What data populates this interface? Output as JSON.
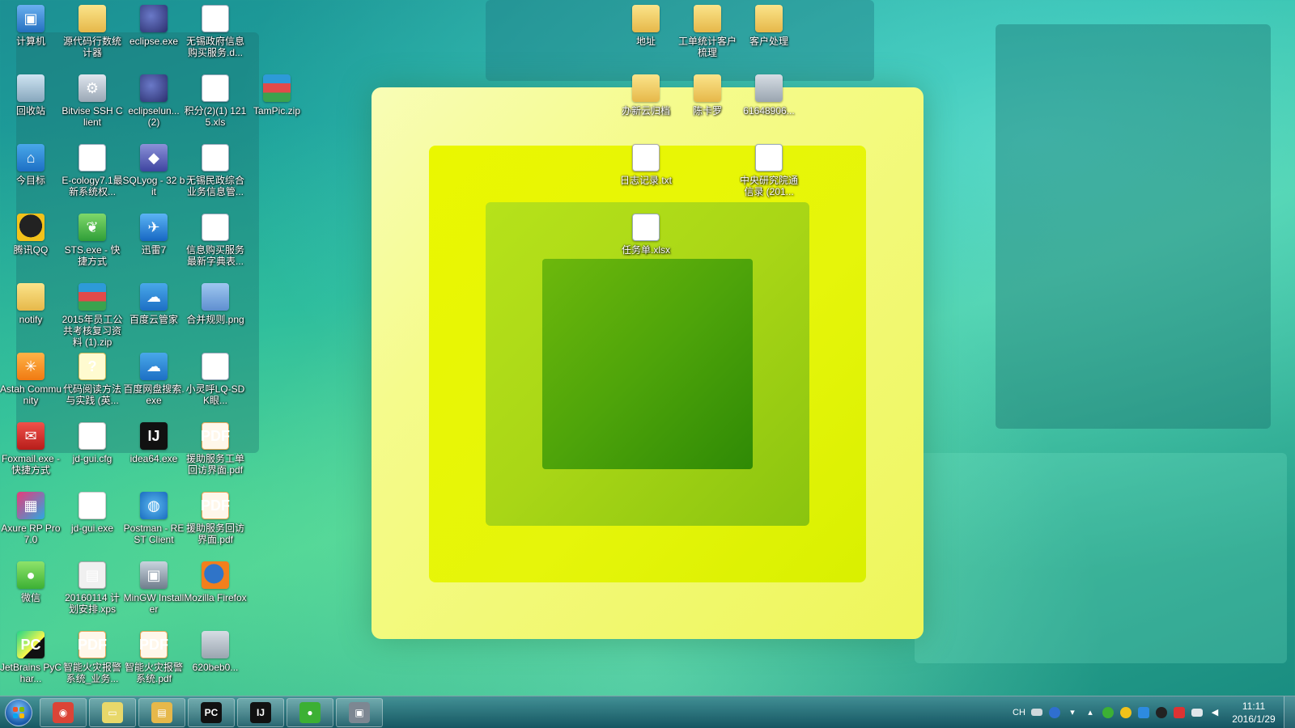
{
  "desktop_icons_left": [
    {
      "label": "计算机",
      "icon": "computer-icon",
      "style": "g-pc",
      "sym": "▣"
    },
    {
      "label": "源代码行数统计器",
      "icon": "folder-icon",
      "style": "g-folder",
      "sym": ""
    },
    {
      "label": "eclipse.exe",
      "icon": "eclipse-icon",
      "style": "g-eclipse",
      "sym": ""
    },
    {
      "label": "无锡政府信息购买服务.d...",
      "icon": "word-doc-icon",
      "style": "g-word",
      "sym": "W"
    },
    {
      "label": "回收站",
      "icon": "recycle-bin-icon",
      "style": "g-bin",
      "sym": ""
    },
    {
      "label": "Bitvise SSH Client",
      "icon": "bitvise-icon",
      "style": "g-ssh",
      "sym": "⚙"
    },
    {
      "label": "eclipselun... (2)",
      "icon": "eclipse-icon",
      "style": "g-eclipse",
      "sym": ""
    },
    {
      "label": "积分(2)(1) 1215.xls",
      "icon": "excel-icon",
      "style": "g-excel",
      "sym": "X"
    },
    {
      "label": "TamPic.zip",
      "icon": "zip-archive-icon",
      "style": "g-zip",
      "sym": ""
    },
    {
      "label": "今目标",
      "icon": "jinmubiao-icon",
      "style": "g-blue",
      "sym": "⌂"
    },
    {
      "label": "E-cology7.1最新系统权...",
      "icon": "word-doc-icon",
      "style": "g-word",
      "sym": "W"
    },
    {
      "label": "SQLyog - 32 bit",
      "icon": "sqlyog-icon",
      "style": "g-db",
      "sym": "◆"
    },
    {
      "label": "无锡民政综合业务信息管...",
      "icon": "excel-icon",
      "style": "g-excel",
      "sym": "X"
    },
    {
      "label": "腾讯QQ",
      "icon": "qq-penguin-icon",
      "style": "g-penguin",
      "sym": ""
    },
    {
      "label": "STS.exe - 快捷方式",
      "icon": "sts-leaf-icon",
      "style": "g-green",
      "sym": "❦"
    },
    {
      "label": "迅雷7",
      "icon": "xunlei-bird-icon",
      "style": "g-bird",
      "sym": "✈"
    },
    {
      "label": "信息购买服务最新字典表...",
      "icon": "excel-icon",
      "style": "g-excel",
      "sym": "X"
    },
    {
      "label": "notify",
      "icon": "folder-icon",
      "style": "g-folder",
      "sym": ""
    },
    {
      "label": "2015年员工公共考核复习资料 (1).zip",
      "icon": "zip-archive-icon",
      "style": "g-zip",
      "sym": ""
    },
    {
      "label": "百度云管家",
      "icon": "baidu-cloud-icon",
      "style": "g-blue",
      "sym": "☁"
    },
    {
      "label": "合并规则.png",
      "icon": "image-file-icon",
      "style": "g-png",
      "sym": ""
    },
    {
      "label": "Astah Community",
      "icon": "astah-icon",
      "style": "g-orange",
      "sym": "✳"
    },
    {
      "label": "代码阅读方法与实践 (英...",
      "icon": "help-file-icon",
      "style": "g-question",
      "sym": "?"
    },
    {
      "label": "百度网盘搜索.exe",
      "icon": "baidu-search-icon",
      "style": "g-blue",
      "sym": "☁"
    },
    {
      "label": "小灵呼LQ-SDK眼...",
      "icon": "word-doc-icon",
      "style": "g-word",
      "sym": "W"
    },
    {
      "label": "Foxmail.exe - 快捷方式",
      "icon": "foxmail-icon",
      "style": "g-red",
      "sym": "✉"
    },
    {
      "label": "jd-gui.cfg",
      "icon": "blank-file-icon",
      "style": "g-file",
      "sym": ""
    },
    {
      "label": "idea64.exe",
      "icon": "intellij-icon",
      "style": "g-idea",
      "sym": "IJ"
    },
    {
      "label": "援助服务工单回访界面.pdf",
      "icon": "pdf-icon",
      "style": "g-pdf",
      "sym": "PDF"
    },
    {
      "label": "Axure RP Pro 7.0",
      "icon": "axure-icon",
      "style": "g-axure",
      "sym": "▦"
    },
    {
      "label": "jd-gui.exe",
      "icon": "java-cup-icon",
      "style": "g-cup",
      "sym": "☕"
    },
    {
      "label": "Postman - REST Client",
      "icon": "postman-globe-icon",
      "style": "g-world",
      "sym": "◍"
    },
    {
      "label": "援助服务回访界面.pdf",
      "icon": "pdf-icon",
      "style": "g-pdf",
      "sym": "PDF"
    },
    {
      "label": "微信",
      "icon": "wechat-icon",
      "style": "g-wechat",
      "sym": "●"
    },
    {
      "label": "20160114 计划安排.xps",
      "icon": "xps-document-icon",
      "style": "g-xps",
      "sym": "▤"
    },
    {
      "label": "MinGW Installer",
      "icon": "mingw-installer-icon",
      "style": "g-mingw",
      "sym": "▣"
    },
    {
      "label": "Mozilla Firefox",
      "icon": "firefox-icon",
      "style": "g-firefox",
      "sym": ""
    },
    {
      "label": "JetBrains PyChar...",
      "icon": "pycharm-icon",
      "style": "g-pycharm",
      "sym": "PC"
    },
    {
      "label": "智能火灾报警系统_业务...",
      "icon": "pdf-icon",
      "style": "g-pdf",
      "sym": "PDF"
    },
    {
      "label": "智能火灾报警系统.pdf",
      "icon": "pdf-icon",
      "style": "g-pdf",
      "sym": "PDF"
    },
    {
      "label": "620beb0...",
      "icon": "photo-thumbnail-icon",
      "style": "g-photo",
      "sym": ""
    }
  ],
  "desktop_icons_right": [
    {
      "label": "地址",
      "icon": "folder-icon",
      "style": "g-folder",
      "sym": ""
    },
    {
      "label": "工单统计客户梳理",
      "icon": "folder-icon",
      "style": "g-folder",
      "sym": ""
    },
    {
      "label": "客户处理",
      "icon": "folder-icon",
      "style": "g-folder",
      "sym": ""
    },
    {
      "label": "办新云归档",
      "icon": "folder-icon",
      "style": "g-folder",
      "sym": ""
    },
    {
      "label": "陈卡罗",
      "icon": "folder-icon",
      "style": "g-folder",
      "sym": ""
    },
    {
      "label": "61648906...",
      "icon": "photo-thumbnail-icon",
      "style": "g-photo",
      "sym": ""
    },
    {
      "label": "日志记录.txt",
      "icon": "text-file-icon",
      "style": "g-txt",
      "sym": "≡"
    },
    {
      "label": "中央研究院通信录 (201...",
      "icon": "excel-icon",
      "style": "g-excel",
      "sym": "X"
    },
    {
      "label": "任务单.xlsx",
      "icon": "excel-icon",
      "style": "g-excel",
      "sym": "X"
    }
  ],
  "taskbar": {
    "apps": [
      {
        "name": "chrome-taskbar-button",
        "icon": "chrome-icon",
        "sym": "◉",
        "color": "#db4437"
      },
      {
        "name": "sticky-notes-taskbar-button",
        "icon": "sticky-notes-icon",
        "sym": "▭",
        "color": "#e8d86a"
      },
      {
        "name": "explorer-taskbar-button",
        "icon": "file-explorer-icon",
        "sym": "▤",
        "color": "#e6b84a"
      },
      {
        "name": "pycharm-taskbar-button",
        "icon": "pycharm-icon",
        "sym": "PC",
        "color": "#111111"
      },
      {
        "name": "intellij-taskbar-button",
        "icon": "intellij-icon",
        "sym": "IJ",
        "color": "#111111"
      },
      {
        "name": "wechat-taskbar-button",
        "icon": "wechat-icon",
        "sym": "●",
        "color": "#3cb034"
      },
      {
        "name": "photo-viewer-taskbar-button",
        "icon": "photo-thumbnail-icon",
        "sym": "▣",
        "color": "#7d8792"
      }
    ],
    "tray": {
      "ime": "CH",
      "time": "11:11",
      "date": "2016/1/29"
    }
  },
  "colors": {
    "wallpaper_primary": "#1eb1a2",
    "frame_yellow": "#eef65a",
    "frame_green": "#4ea40a",
    "taskbar": "#1f6f80"
  }
}
